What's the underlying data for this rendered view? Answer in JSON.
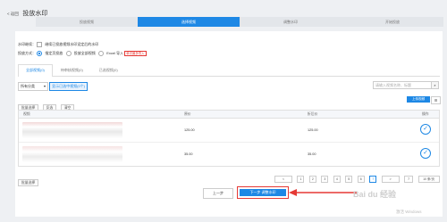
{
  "header": {
    "back": "< 返回",
    "title": "投放水印"
  },
  "steps": [
    {
      "label": "投放视频",
      "active": false
    },
    {
      "label": "选择视频",
      "active": true
    },
    {
      "label": "调整水印",
      "active": false
    },
    {
      "label": "开始投放",
      "active": false
    }
  ],
  "options": {
    "label1": "水印继续：",
    "check1": "继续已投放视频水印设定后的水印",
    "label2": "投放方式：",
    "radio1": "指定页投放",
    "radio2": "投放全部视频",
    "radio3": "Excel 导入",
    "badge": "单次最多导入"
  },
  "tabs": [
    "全部视频(0)",
    "待审核视频(0)",
    "已选视频(0)"
  ],
  "filter": {
    "select": "所有分类",
    "tag": "显示已选中视频(0个)",
    "search_placeholder": "请输入视频名称、标题"
  },
  "actions": {
    "select_all": "批量选择",
    "invert": "反选",
    "clear": "清空",
    "upload": "上传视频"
  },
  "table": {
    "headers": [
      "视频",
      "原价",
      "折后价",
      "操作"
    ],
    "rows": [
      {
        "price": "125.00",
        "sale": "125.00"
      },
      {
        "price": "35.00",
        "sale": "35.00"
      }
    ]
  },
  "pagination": {
    "prev": "<",
    "pages": [
      "1",
      "2",
      "3",
      "4",
      "5",
      "6",
      "7"
    ],
    "active": "7",
    "next": ">",
    "jump_to": "7",
    "size": "10 条/页"
  },
  "footer": {
    "batch": "批量选择",
    "prev_step": "上一步",
    "next_step": "下一步 调整水印"
  },
  "watermark": {
    "text": "Bai du 经验",
    "windows": "激活 Windows"
  },
  "colors": {
    "accent": "#1e88e5",
    "highlight": "#e53935"
  }
}
